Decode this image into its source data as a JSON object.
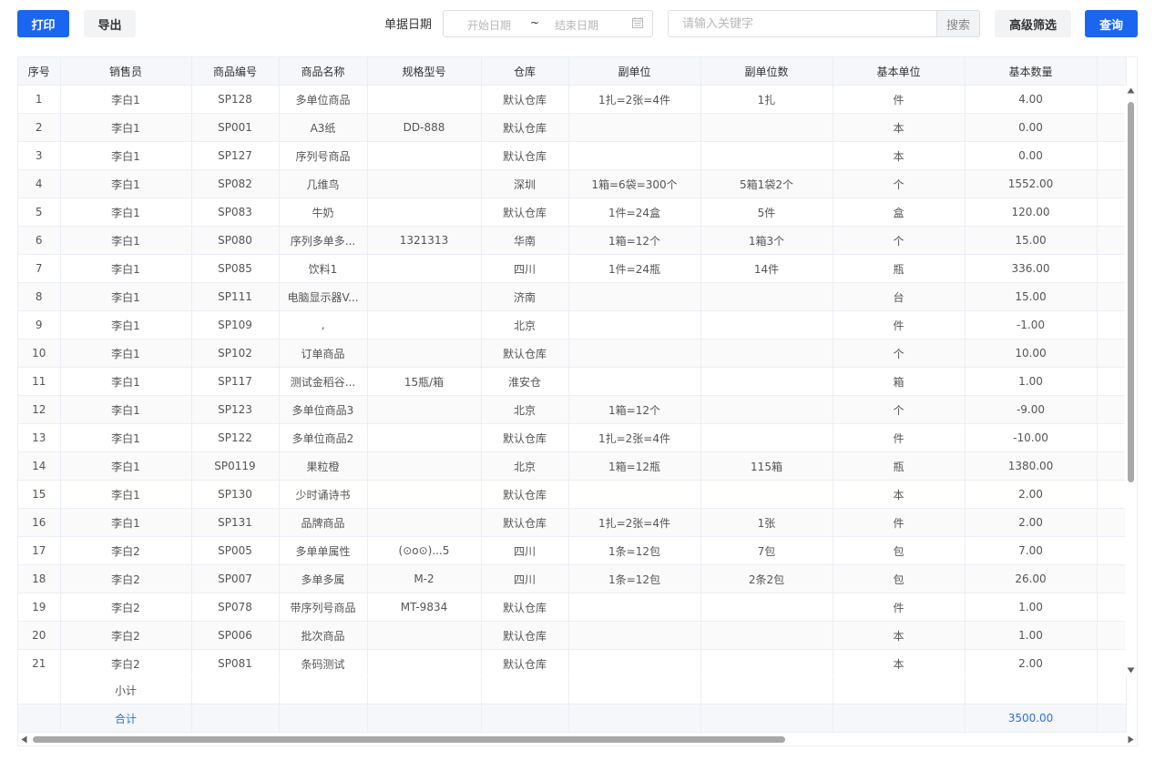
{
  "toolbar": {
    "print_label": "打印",
    "export_label": "导出",
    "date_label": "单据日期",
    "start_date_placeholder": "开始日期",
    "date_separator": "~",
    "end_date_placeholder": "结束日期",
    "keyword_placeholder": "请输入关键字",
    "search_label": "搜索",
    "advanced_filter_label": "高级筛选",
    "query_label": "查询"
  },
  "table": {
    "columns": [
      "序号",
      "销售员",
      "商品编号",
      "商品名称",
      "规格型号",
      "仓库",
      "副单位",
      "副单位数",
      "基本单位",
      "基本数量"
    ],
    "rows": [
      [
        "1",
        "李白1",
        "SP128",
        "多单位商品",
        "",
        "默认仓库",
        "1扎=2张=4件",
        "1扎",
        "件",
        "4.00"
      ],
      [
        "2",
        "李白1",
        "SP001",
        "A3纸",
        "DD-888",
        "默认仓库",
        "",
        "",
        "本",
        "0.00"
      ],
      [
        "3",
        "李白1",
        "SP127",
        "序列号商品",
        "",
        "默认仓库",
        "",
        "",
        "本",
        "0.00"
      ],
      [
        "4",
        "李白1",
        "SP082",
        "几维鸟",
        "",
        "深圳",
        "1箱=6袋=300个",
        "5箱1袋2个",
        "个",
        "1552.00"
      ],
      [
        "5",
        "李白1",
        "SP083",
        "牛奶",
        "",
        "默认仓库",
        "1件=24盒",
        "5件",
        "盒",
        "120.00"
      ],
      [
        "6",
        "李白1",
        "SP080",
        "序列多单多...",
        "1321313",
        "华南",
        "1箱=12个",
        "1箱3个",
        "个",
        "15.00"
      ],
      [
        "7",
        "李白1",
        "SP085",
        "饮料1",
        "",
        "四川",
        "1件=24瓶",
        "14件",
        "瓶",
        "336.00"
      ],
      [
        "8",
        "李白1",
        "SP111",
        "电脑显示器V...",
        "",
        "济南",
        "",
        "",
        "台",
        "15.00"
      ],
      [
        "9",
        "李白1",
        "SP109",
        ",",
        "",
        "北京",
        "",
        "",
        "件",
        "-1.00"
      ],
      [
        "10",
        "李白1",
        "SP102",
        "订单商品",
        "",
        "默认仓库",
        "",
        "",
        "个",
        "10.00"
      ],
      [
        "11",
        "李白1",
        "SP117",
        "测试金稻谷...",
        "15瓶/箱",
        "淮安仓",
        "",
        "",
        "箱",
        "1.00"
      ],
      [
        "12",
        "李白1",
        "SP123",
        "多单位商品3",
        "",
        "北京",
        "1箱=12个",
        "",
        "个",
        "-9.00"
      ],
      [
        "13",
        "李白1",
        "SP122",
        "多单位商品2",
        "",
        "默认仓库",
        "1扎=2张=4件",
        "",
        "件",
        "-10.00"
      ],
      [
        "14",
        "李白1",
        "SP0119",
        "果粒橙",
        "",
        "北京",
        "1箱=12瓶",
        "115箱",
        "瓶",
        "1380.00"
      ],
      [
        "15",
        "李白1",
        "SP130",
        "少时诵诗书",
        "",
        "默认仓库",
        "",
        "",
        "本",
        "2.00"
      ],
      [
        "16",
        "李白1",
        "SP131",
        "品牌商品",
        "",
        "默认仓库",
        "1扎=2张=4件",
        "1张",
        "件",
        "2.00"
      ],
      [
        "17",
        "李白2",
        "SP005",
        "多单单属性",
        "(⊙o⊙)...5",
        "四川",
        "1条=12包",
        "7包",
        "包",
        "7.00"
      ],
      [
        "18",
        "李白2",
        "SP007",
        "多单多属",
        "M-2",
        "四川",
        "1条=12包",
        "2条2包",
        "包",
        "26.00"
      ],
      [
        "19",
        "李白2",
        "SP078",
        "带序列号商品",
        "MT-9834",
        "默认仓库",
        "",
        "",
        "件",
        "1.00"
      ],
      [
        "20",
        "李白2",
        "SP006",
        "批次商品",
        "",
        "默认仓库",
        "",
        "",
        "本",
        "1.00"
      ],
      [
        "21",
        "李白2",
        "SP081",
        "条码测试",
        "",
        "默认仓库",
        "",
        "",
        "本",
        "2.00"
      ]
    ],
    "subtotal_label": "小计",
    "total_label": "合计",
    "total_value": "3500.00"
  },
  "colors": {
    "primary": "#1a66f0",
    "link_blue": "#2f6ee8",
    "header_bg": "#f5f7fa",
    "border": "#ebeef5"
  }
}
